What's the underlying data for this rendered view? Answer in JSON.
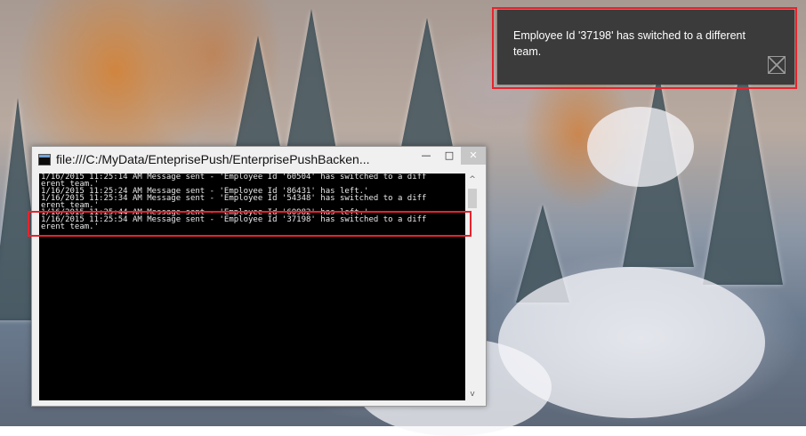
{
  "toast": {
    "message": "Employee Id '37198' has switched to a different team.",
    "image_icon": "broken-image-icon"
  },
  "console_window": {
    "title": "file:///C:/MyData/EnteprisePush/EnterprisePushBacken...",
    "icon": "console-app-icon",
    "minimize_label": "—",
    "maximize_label": "□",
    "close_label": "✕",
    "scroll_up": "^",
    "scroll_down": "v",
    "lines": [
      "1/16/2015 11:25:14 AM Message sent - 'Employee Id '60504' has switched to a diff",
      "erent team.'",
      "1/16/2015 11:25:24 AM Message sent - 'Employee Id '86431' has left.'",
      "1/16/2015 11:25:34 AM Message sent - 'Employee Id '54348' has switched to a diff",
      "erent team.'",
      "1/16/2015 11:25:44 AM Message sent - 'Employee Id '60982' has left.'",
      "1/16/2015 11:25:54 AM Message sent - 'Employee Id '37198' has switched to a diff",
      "erent team.'"
    ]
  },
  "colors": {
    "highlight": "#e8232d",
    "toast_background": "#3b3b3b",
    "console_background": "#000000"
  }
}
